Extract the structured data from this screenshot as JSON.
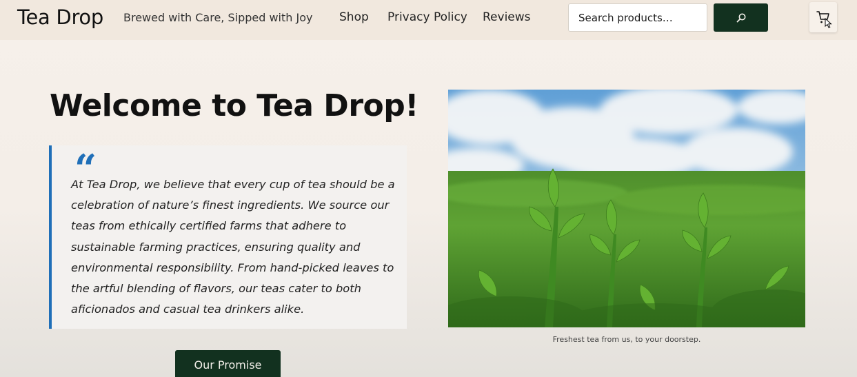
{
  "header": {
    "brand": "Tea Drop",
    "tagline": "Brewed with Care, Sipped with Joy",
    "nav": [
      {
        "label": "Shop"
      },
      {
        "label": "Privacy Policy"
      },
      {
        "label": "Reviews"
      }
    ],
    "search": {
      "placeholder": "Search products…",
      "button_icon": "search-icon"
    },
    "cart_icon": "cart-icon"
  },
  "hero": {
    "title": "Welcome to Tea Drop!",
    "quote_mark": "“",
    "quote": "At Tea Drop, we believe that every cup of tea should be a celebration of nature’s finest ingredients. We source our teas from ethically certified farms that adhere to sustainable farming practices, ensuring quality and environmental responsibility. From hand-picked leaves to the artful blending of flavors, our teas cater to both aficionados and casual tea drinkers alike.",
    "button": "Our Promise",
    "image_caption": "Freshest tea from us, to your doorstep."
  },
  "colors": {
    "header_bg": "#f1e8de",
    "accent_dark_green": "#12311f",
    "quote_border": "#1f6fb8",
    "page_bg": "#f6f0ea"
  }
}
